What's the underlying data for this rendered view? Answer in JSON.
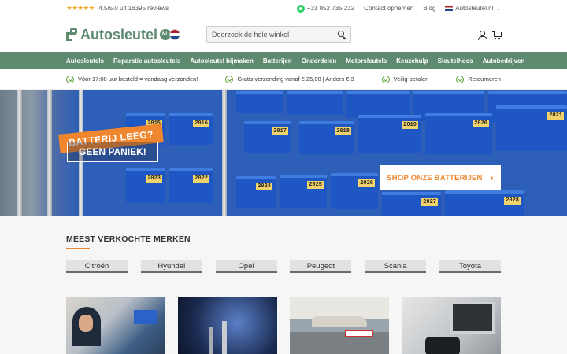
{
  "topbar": {
    "stars": "★★★★★",
    "rating_text": "4.5/5.0 uit 16395 reviews",
    "phone": "+31 852 735 232",
    "contact": "Contact opnemen",
    "blog": "Blog",
    "site_selector": "Autosleutel.nl"
  },
  "header": {
    "logo_text": "Autosleutel",
    "logo_badge": "NL",
    "search_placeholder": "Doorzoek de hele winkel"
  },
  "nav": {
    "items": [
      {
        "label": "Autosleutels"
      },
      {
        "label": "Reparatie autosleutels"
      },
      {
        "label": "Autosleutel bijmaken"
      },
      {
        "label": "Batterijen"
      },
      {
        "label": "Onderdelen"
      },
      {
        "label": "Motorsleutels"
      },
      {
        "label": "Keuzehulp"
      },
      {
        "label": "Sleutelhoes"
      },
      {
        "label": "Autobedrijven"
      }
    ]
  },
  "usp": {
    "items": [
      {
        "label": "Vóór 17:00 uur besteld = vandaag verzonden!"
      },
      {
        "label": "Gratis verzending vanaf € 25,00 | Anders € 3"
      },
      {
        "label": "Veilig betalen"
      },
      {
        "label": "Retourneren"
      }
    ]
  },
  "hero": {
    "promo_line1": "BATTERIJ LEEG?",
    "promo_line2": "GEEN PANIEK!",
    "cta": "SHOP ONZE BATTERIJEN",
    "bin_labels": [
      "2015",
      "2016",
      "2017",
      "2018",
      "2019",
      "2020",
      "2021",
      "2022",
      "2023",
      "2024",
      "2025",
      "2026",
      "2027",
      "2028"
    ]
  },
  "brands": {
    "title": "MEEST VERKOCHTE MERKEN",
    "items": [
      {
        "label": "Citroën"
      },
      {
        "label": "Hyundai"
      },
      {
        "label": "Opel"
      },
      {
        "label": "Peugeot"
      },
      {
        "label": "Scania"
      },
      {
        "label": "Toyota"
      }
    ]
  },
  "colors": {
    "brand_green": "#5e8a6f",
    "accent_orange": "#f0862d",
    "check_green": "#5ea032"
  }
}
